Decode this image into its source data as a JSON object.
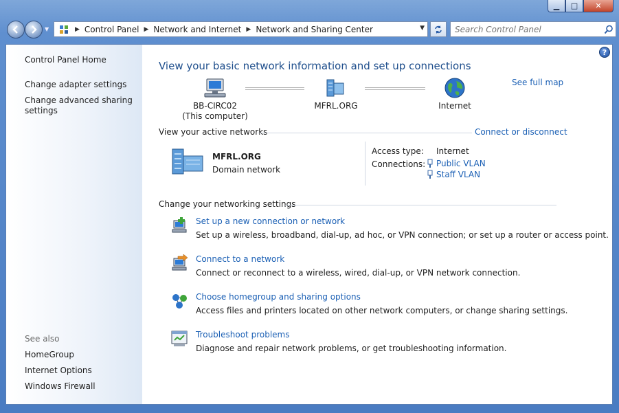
{
  "window": {
    "minimize_glyph": "▁",
    "maximize_glyph": "□",
    "close_glyph": "✕"
  },
  "address_bar": {
    "crumbs": [
      "Control Panel",
      "Network and Internet",
      "Network and Sharing Center"
    ],
    "separator": "▶"
  },
  "search": {
    "placeholder": "Search Control Panel"
  },
  "sidebar": {
    "home": "Control Panel Home",
    "links": [
      "Change adapter settings",
      "Change advanced sharing settings"
    ],
    "see_also_label": "See also",
    "see_also": [
      "HomeGroup",
      "Internet Options",
      "Windows Firewall"
    ]
  },
  "main": {
    "title": "View your basic network information and set up connections",
    "see_full_map": "See full map",
    "map": {
      "computer_name": "BB-CIRC02",
      "computer_sub": "(This computer)",
      "network": "MFRL.ORG",
      "internet": "Internet"
    },
    "active_networks_label": "View your active networks",
    "connect_or_disconnect": "Connect or disconnect",
    "active_network": {
      "name": "MFRL.ORG",
      "type": "Domain network",
      "access_type_label": "Access type:",
      "access_type_value": "Internet",
      "connections_label": "Connections:",
      "connections": [
        "Public VLAN",
        "Staff VLAN"
      ]
    },
    "change_settings_label": "Change your networking settings",
    "tasks": [
      {
        "link": "Set up a new connection or network",
        "desc": "Set up a wireless, broadband, dial-up, ad hoc, or VPN connection; or set up a router or access point.",
        "icon": "new-connection-icon"
      },
      {
        "link": "Connect to a network",
        "desc": "Connect or reconnect to a wireless, wired, dial-up, or VPN network connection.",
        "icon": "connect-network-icon"
      },
      {
        "link": "Choose homegroup and sharing options",
        "desc": "Access files and printers located on other network computers, or change sharing settings.",
        "icon": "homegroup-icon"
      },
      {
        "link": "Troubleshoot problems",
        "desc": "Diagnose and repair network problems, or get troubleshooting information.",
        "icon": "troubleshoot-icon"
      }
    ]
  },
  "colors": {
    "link": "#1a5fb4",
    "title": "#1e4e8c",
    "frame": "#4a7cc2"
  }
}
